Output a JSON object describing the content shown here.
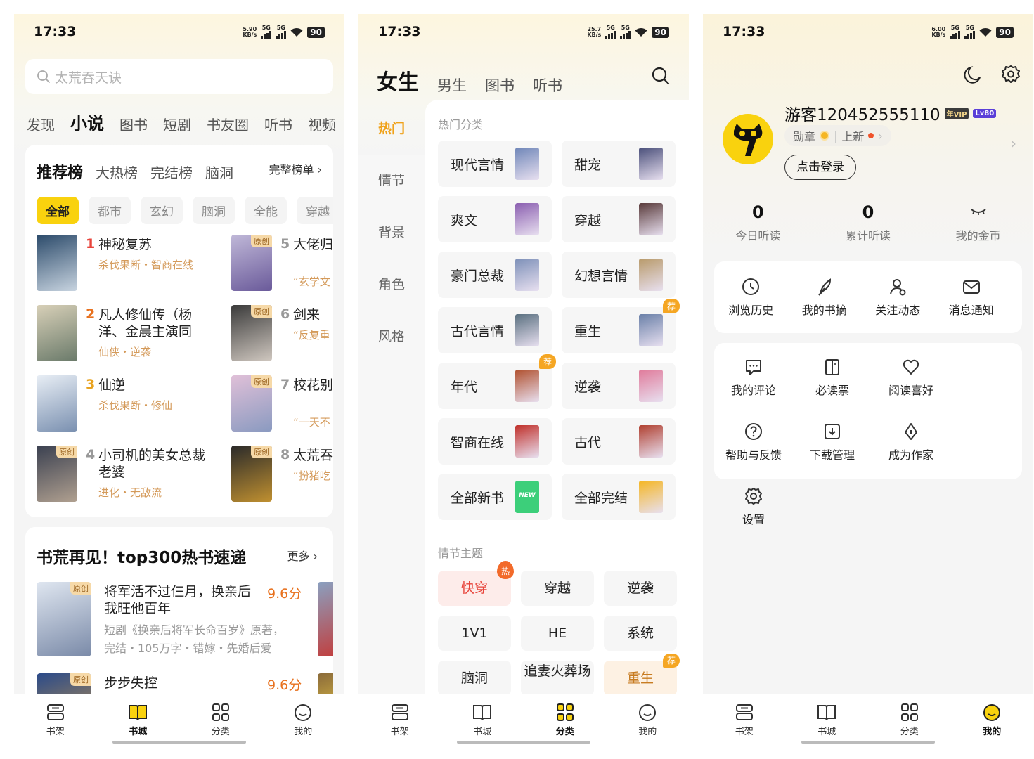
{
  "status": [
    {
      "time": "17:33",
      "net_speed": "5.90",
      "net_unit": "KB/s",
      "sim1": "5G",
      "sim2": "5G",
      "battery": "90"
    },
    {
      "time": "17:33",
      "net_speed": "25.7",
      "net_unit": "KB/s",
      "sim1": "5G",
      "sim2": "5G",
      "battery": "90"
    },
    {
      "time": "17:33",
      "net_speed": "6.00",
      "net_unit": "KB/s",
      "sim1": "5G",
      "sim2": "5G",
      "battery": "90"
    }
  ],
  "bookstore": {
    "search_placeholder": "太荒吞天诀",
    "tabs": [
      "发现",
      "小说",
      "图书",
      "短剧",
      "书友圈",
      "听书",
      "视频"
    ],
    "active_tab": "小说",
    "rank_tabs": [
      "推荐榜",
      "大热榜",
      "完结榜",
      "脑洞"
    ],
    "rank_more": "完整榜单",
    "chips": [
      "全部",
      "都市",
      "玄幻",
      "脑洞",
      "全能",
      "穿越"
    ],
    "rank_items": [
      {
        "rank": "1",
        "title": "神秘复苏",
        "sub": "杀伐果断・智商在线",
        "rank_color": "#e8453c"
      },
      {
        "rank": "2",
        "title": "凡人修仙传（杨洋、金晨主演同",
        "sub": "仙侠・逆袭",
        "rank_color": "#e8711e"
      },
      {
        "rank": "3",
        "title": "仙逆",
        "sub": "杀伐果断・修仙",
        "rank_color": "#e8a21e"
      },
      {
        "rank": "4",
        "title": "小司机的美女总裁老婆",
        "sub": "进化・无敌流",
        "rank_color": "#999999",
        "badge": "原创"
      },
      {
        "rank": "5",
        "title": "大佬归金她不",
        "sub": "“玄学文",
        "rank_color": "#999999",
        "badge": "原创"
      },
      {
        "rank": "6",
        "title": "剑来",
        "sub": "“反复重",
        "rank_color": "#999999",
        "badge": "原创"
      },
      {
        "rank": "7",
        "title": "校花别冷女同",
        "sub": "“一天不",
        "rank_color": "#999999",
        "badge": "原创"
      },
      {
        "rank": "8",
        "title": "太荒吞",
        "sub": "“扮猪吃",
        "rank_color": "#999999",
        "badge": "原创"
      }
    ],
    "hot_section": {
      "title": "书荒再见！top300热书速递",
      "more": "更多",
      "books": [
        {
          "title": "将军活不过仨月，换亲后我旺他百年",
          "score": "9.6分",
          "desc": "短剧《换亲后将军长命百岁》原著，完结・105万字・错嫁・先婚后爱",
          "badge": "原创"
        },
        {
          "title": "步步失控",
          "score": "9.6分",
          "desc": "",
          "badge": "原创"
        }
      ]
    }
  },
  "category": {
    "tabs": [
      "女生",
      "男生",
      "图书",
      "听书"
    ],
    "active_tab": "女生",
    "sidebar": [
      "热门",
      "情节",
      "背景",
      "角色",
      "风格"
    ],
    "active_side": "热门",
    "section1": "热门分类",
    "categories": [
      {
        "label": "现代言情",
        "thumb": "#6f86b8"
      },
      {
        "label": "甜宠",
        "thumb": "#4a4f7a"
      },
      {
        "label": "爽文",
        "thumb": "#8b5fb0"
      },
      {
        "label": "穿越",
        "thumb": "#5a3b3b"
      },
      {
        "label": "豪门总裁",
        "thumb": "#7d90b8"
      },
      {
        "label": "幻想言情",
        "thumb": "#b89a6a"
      },
      {
        "label": "古代言情",
        "thumb": "#5a7080"
      },
      {
        "label": "重生",
        "thumb": "#6a80a8",
        "tag": "荐"
      },
      {
        "label": "年代",
        "thumb": "#b0502e",
        "tag": "荐"
      },
      {
        "label": "逆袭",
        "thumb": "#e07a9a"
      },
      {
        "label": "智商在线",
        "thumb": "#c0302a"
      },
      {
        "label": "古代",
        "thumb": "#b04030"
      },
      {
        "label": "全部新书",
        "thumb": "#3ccf7a",
        "thumb_text": "NEW"
      },
      {
        "label": "全部完结",
        "thumb": "#f5b623"
      }
    ],
    "section2": "情节主题",
    "topics": [
      {
        "label": "快穿",
        "style": "hot",
        "mark": "热"
      },
      {
        "label": "穿越",
        "style": ""
      },
      {
        "label": "逆袭",
        "style": ""
      },
      {
        "label": "1V1",
        "style": ""
      },
      {
        "label": "HE",
        "style": ""
      },
      {
        "label": "系统",
        "style": ""
      },
      {
        "label": "脑洞",
        "style": ""
      },
      {
        "label": "追妻火葬场",
        "style": ""
      },
      {
        "label": "重生",
        "style": "warm",
        "tag": "荐"
      }
    ]
  },
  "mine": {
    "username": "游客120452555110",
    "badge_vip": "年VIP",
    "badge_lv": "Lv80",
    "medal": "勋章",
    "update": "上新",
    "login": "点击登录",
    "stats": [
      {
        "value": "0",
        "label": "今日听读"
      },
      {
        "value": "0",
        "label": "累计听读"
      },
      {
        "value": "",
        "label": "我的金币"
      }
    ],
    "quick": [
      {
        "label": "浏览历史",
        "icon": "clock-icon"
      },
      {
        "label": "我的书摘",
        "icon": "quill-icon"
      },
      {
        "label": "关注动态",
        "icon": "user-follow-icon"
      },
      {
        "label": "消息通知",
        "icon": "mail-icon"
      }
    ],
    "services": [
      {
        "label": "我的评论",
        "icon": "comment-icon"
      },
      {
        "label": "必读票",
        "icon": "ticket-book-icon"
      },
      {
        "label": "阅读喜好",
        "icon": "heart-icon"
      },
      {
        "label": "帮助与反馈",
        "icon": "help-icon"
      },
      {
        "label": "下载管理",
        "icon": "download-icon"
      },
      {
        "label": "成为作家",
        "icon": "pen-nib-icon"
      },
      {
        "label": "设置",
        "icon": "gear-icon"
      }
    ]
  },
  "bottom_nav": [
    "书架",
    "书城",
    "分类",
    "我的"
  ],
  "nav_active": [
    "书城",
    "分类",
    "我的"
  ],
  "colors": {
    "accent": "#f9d20e",
    "orange": "#f0a21a",
    "score": "#e8711e"
  }
}
